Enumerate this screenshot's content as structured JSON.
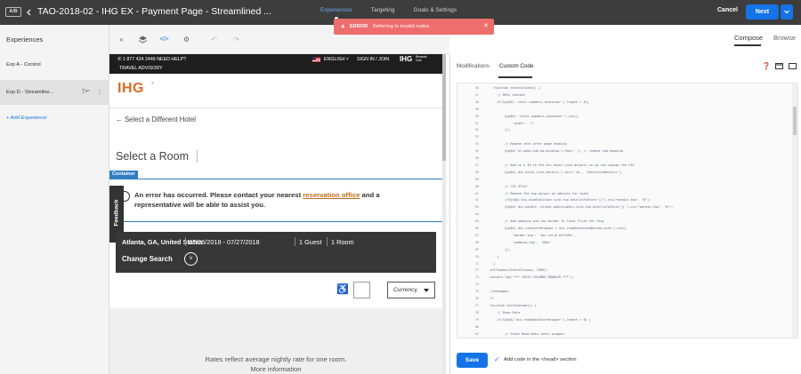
{
  "topbar": {
    "badge": "A/B",
    "title": "TAO-2018-02 - IHG EX - Payment Page - Streamlined ...",
    "tabs": [
      "Experiences",
      "Targeting",
      "Goals & Settings"
    ],
    "active_tab": "Experiences",
    "cancel_label": "Cancel",
    "next_label": "Next"
  },
  "toast": {
    "label": "ERROR",
    "message": "Referring to invalid nodes"
  },
  "sidebar": {
    "title": "Experiences",
    "items": [
      {
        "label": "Exp A - Control",
        "selected": false
      },
      {
        "label": "Exp D - Streamline...",
        "selected": true
      }
    ],
    "add_label": "+ Add Experience"
  },
  "view_tabs": {
    "compose": "Compose",
    "browse": "Browse"
  },
  "preview": {
    "nav": {
      "phone": "1 877 424 2449   NEED HELP?",
      "advisory": "TRAVEL ADVISORY",
      "language": "ENGLISH",
      "signin": "SIGN IN / JOIN",
      "logo": "IHG",
      "logo_sub": "Rewards Club"
    },
    "brand_logo": "IHG",
    "select_hotel": "← Select a Different Hotel",
    "select_room": "Select a Room",
    "container_tag": "Container",
    "error_text_1": "An error has occurred. Please contact your nearest ",
    "error_link": "reservation office",
    "error_text_2": " and a representative will be able to assist you.",
    "feedback": "Feedback",
    "search": {
      "location": "Atlanta, GA, United States",
      "dates": "07/26/2018 - 07/27/2018",
      "guests": "1 Guest",
      "rooms": "1 Room",
      "change": "Change Search"
    },
    "currency": "Currency",
    "rates_note": "Rates reflect average nightly rate for one room.",
    "rates_note_2": "More information"
  },
  "right_panel": {
    "tabs": [
      "Modifications",
      "Custom Code"
    ],
    "active_tab": "Custom Code",
    "code_lines": [
      {
        "n": "46",
        "t": "    function tasteColumns() {"
      },
      {
        "n": "47",
        "t": "      // DESC content"
      },
      {
        "n": "48",
        "t": "      if($jq$$('.intel-numbers-container').length > 0){"
      },
      {
        "n": "49",
        "t": ""
      },
      {
        "n": "50",
        "t": "          $jq$$('.intel-numbers-container').css({"
      },
      {
        "n": "51",
        "t": "              'width': '1'"
      },
      {
        "n": "52",
        "t": "          });"
      },
      {
        "n": "53",
        "t": ""
      },
      {
        "n": "54",
        "t": "          // Remove text after page heading"
      },
      {
        "n": "55",
        "t": "          $jq$$('h1.page-sub-bg-binding').html(''); // remove sub-heading"
      },
      {
        "n": "56",
        "t": ""
      },
      {
        "n": "57",
        "t": "          // Add in a ID to the div.hotel-info-details so we can change the CSS."
      },
      {
        "n": "58",
        "t": "          $jq$$('div.hotel-info-details').attr('id', 'hotelinfoDetails');"
      },
      {
        "n": "59",
        "t": ""
      },
      {
        "n": "60",
        "t": "          // CSS STYLE"
      },
      {
        "n": "61",
        "t": "          // Remove the top margin on address for hotel"
      },
      {
        "n": "62",
        "t": "          //$jq$$('div.middleColumn.site-top-hotelinfoStore')[\"].css(\"margin-top\", \"0\");"
      },
      {
        "n": "63",
        "t": "          $jq$$('div.middle .street-address#div.site-top-hotelinfoStore')['].css(\"margin-top\", \"0\");"
      },
      {
        "n": "64",
        "t": ""
      },
      {
        "n": "65",
        "t": "          // Add padding and top border to Total Price for Stay"
      },
      {
        "n": "66",
        "t": "          $jq$$('div.itemLeftWrapper > div.roomRateGrandBottom.pine').css({"
      },
      {
        "n": "67",
        "t": "              'border-top': '1px solid #472d9c',"
      },
      {
        "n": "68",
        "t": "              'padding-top': '10px'"
      },
      {
        "n": "69",
        "t": "          });"
      },
      {
        "n": "70",
        "t": "      }"
      },
      {
        "n": "71",
        "t": "    }"
      },
      {
        "n": "72",
        "t": "  setTimeout(tasteColumns, 1500);"
      },
      {
        "n": "73",
        "t": "  console.log('*** TASTE COLUMNS ENABLED ***');"
      },
      {
        "n": "74",
        "t": ""
      },
      {
        "n": "75",
        "t": "  //debugger;"
      },
      {
        "n": "76",
        "t": "  /*"
      },
      {
        "n": "77",
        "t": "  function tasteColumns() {"
      },
      {
        "n": "78",
        "t": "      // Room Data"
      },
      {
        "n": "79",
        "t": "      if($jq$$('div.roomDataInnerWrapper').length > 0) {"
      },
      {
        "n": "80",
        "t": ""
      },
      {
        "n": "81",
        "t": "          // Saves Room Data inner wrapper"
      },
      {
        "n": "82",
        "t": "          $jq$$('div.roomDataInnerWrapper, div.roomRateContainer-gpl').css({"
      }
    ],
    "save_label": "Save",
    "head_label": "Add code in the <head> section"
  },
  "colors": {
    "accent": "#1473e6",
    "topbar": "#3d3d3d",
    "error": "#ee6d6d",
    "ihg_orange": "#e06a20"
  }
}
